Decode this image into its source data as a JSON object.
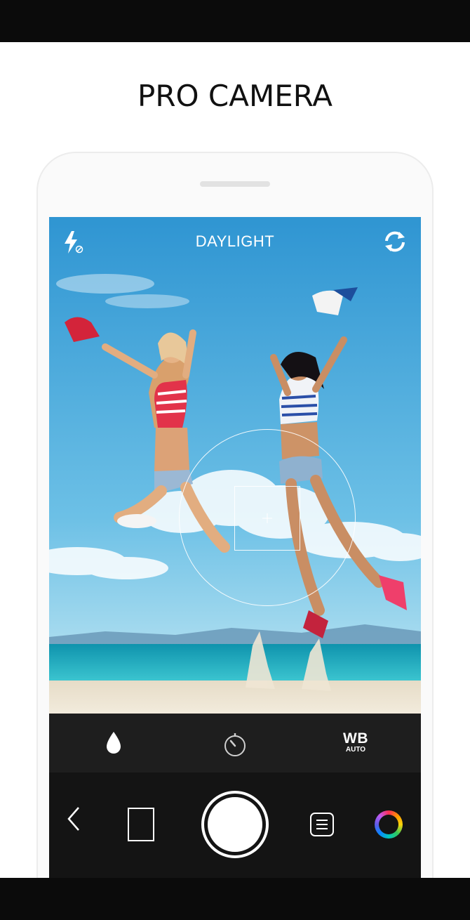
{
  "page": {
    "title": "PRO CAMERA"
  },
  "camera": {
    "mode_label": "DAYLIGHT",
    "wb": {
      "label": "WB",
      "sub": "AUTO"
    }
  },
  "icons": {
    "flash": "flash-off-icon",
    "switch": "camera-switch-icon",
    "drop": "water-drop-icon",
    "timer": "timer-icon",
    "back": "chevron-left-icon",
    "menu": "menu-lines-icon",
    "color": "color-wheel-icon"
  },
  "colors": {
    "sky": "#3aa3d8",
    "sea": "#1fb3c6",
    "sand": "#eae1cf",
    "control_bar": "#1e1e1e",
    "bottom_bar": "#141414"
  }
}
